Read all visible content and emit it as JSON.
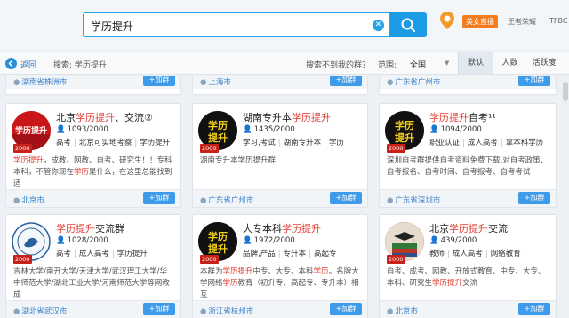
{
  "search": {
    "query": "学历提升"
  },
  "header": {
    "live_label": "美女直播",
    "user_name": "王者荣耀",
    "user_extra": "TFBC"
  },
  "filter": {
    "back_label": "返回",
    "breadcrumb": "搜索: 学历提升",
    "not_found": "搜索不到我的群？",
    "range_label": "范围:",
    "range_value": "全国",
    "sort_tabs": [
      "默认",
      "人数",
      "活跃度"
    ]
  },
  "add_label": "+加群",
  "top_row": [
    "湖南省株洲市",
    "上海市",
    "广东省广州市"
  ],
  "cards": [
    {
      "title": "北京学历提升、交流②",
      "members": "1093/2000",
      "tags": [
        "高考",
        "北京可实地考察",
        "学历提升"
      ],
      "desc": "学历提升，成教、网教、自考、研究生！！专科本科，不管你现在学历是什么，在这里总能找到适",
      "location": "北京市",
      "avatar_text": "学历提升",
      "avatar_num": "2000"
    },
    {
      "title": "湖南专升本学历提升",
      "members": "1435/2000",
      "tags": [
        "学习,考试",
        "湖南专升本",
        "学历"
      ],
      "desc": "湖南专升本学历提升群",
      "location": "广东省广州市",
      "avatar_text": "学历提升",
      "avatar_num": "2000"
    },
    {
      "title": "学历提升自考¹¹",
      "members": "1094/2000",
      "tags": [
        "职业认证",
        "成人高考",
        "拿本科学历"
      ],
      "desc": "深圳自考群提供自考资料免费下载,对自考政策、自考报名、自考时间、自考报考、自考考试",
      "location": "广东省深圳市",
      "avatar_text": "学历提升",
      "avatar_num": "2000"
    },
    {
      "title": "学历提升交流群",
      "members": "1028/2000",
      "tags": [
        "高考",
        "成人高考",
        "学历提升"
      ],
      "desc": "吉林大学/南开大学/天津大学/武汉理工大学/华中师范大学/湖北工业大学/河南师范大学等网教成",
      "location": "湖北省武汉市",
      "avatar_text": "",
      "avatar_num": "2000"
    },
    {
      "title": "大专本科学历提升",
      "members": "1972/2000",
      "tags": [
        "品牌,产品",
        "专升本",
        "高起专"
      ],
      "desc": "本群为学历提升中专、大专、本科学历。名牌大学网络学历教育（初升专、高起专、专升本）相互",
      "location": "浙江省杭州市",
      "avatar_text": "学历提升",
      "avatar_num": "2000"
    },
    {
      "title": "北京学历提升交流",
      "members": "439/2000",
      "tags": [
        "教师",
        "成人高考",
        "网络教育"
      ],
      "desc": "自考、成考、网教、开放式教育、中专、大专、本科、研究生学历提升交流",
      "location": "北京市",
      "avatar_text": "",
      "avatar_num": "2000"
    }
  ],
  "colors": {
    "accent": "#1d9be5",
    "highlight": "#e33e33",
    "badge": "#f47c20"
  }
}
